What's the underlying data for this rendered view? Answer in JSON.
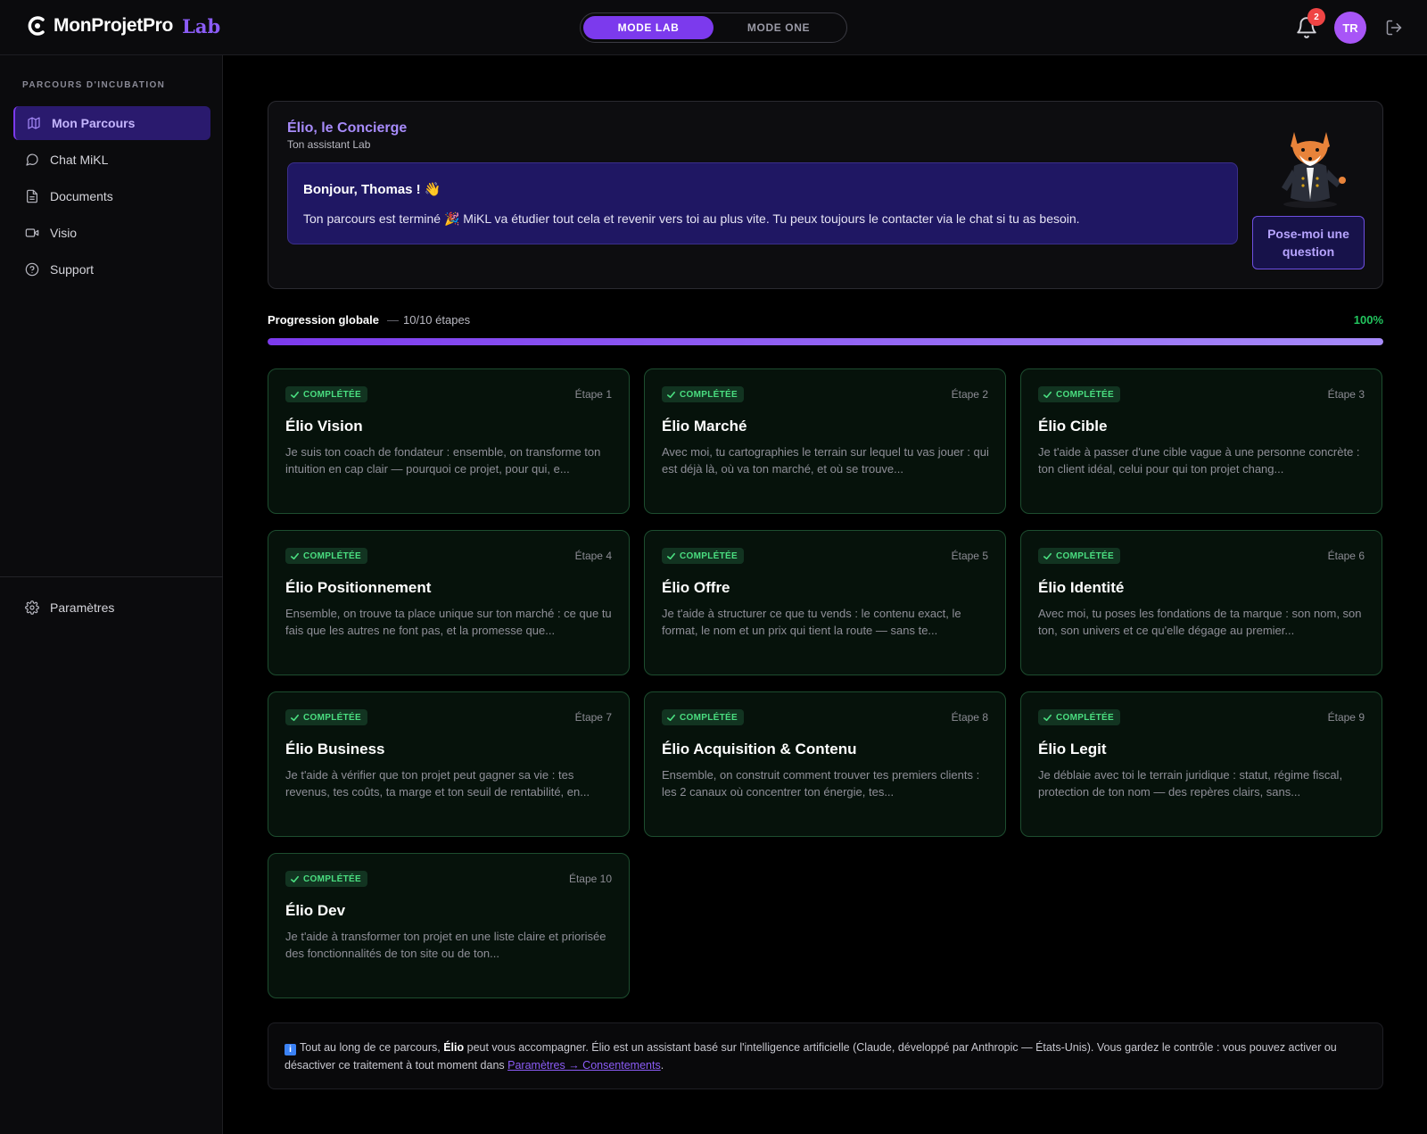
{
  "brand": {
    "name": "MonProjetPro",
    "suffix": "Lab"
  },
  "modes": [
    {
      "label": "MODE LAB",
      "active": true
    },
    {
      "label": "MODE ONE",
      "active": false
    }
  ],
  "notifications": {
    "count": "2"
  },
  "user": {
    "initials": "TR"
  },
  "sidebar": {
    "heading": "PARCOURS D'INCUBATION",
    "items": [
      {
        "label": "Mon Parcours",
        "icon": "map-icon",
        "active": true
      },
      {
        "label": "Chat MiKL",
        "icon": "chat-bubble-icon"
      },
      {
        "label": "Documents",
        "icon": "document-icon"
      },
      {
        "label": "Visio",
        "icon": "video-camera-icon"
      },
      {
        "label": "Support",
        "icon": "help-circle-icon"
      }
    ],
    "settings": {
      "label": "Paramètres",
      "icon": "gear-icon"
    }
  },
  "concierge": {
    "title": "Élio, le Concierge",
    "subtitle": "Ton assistant Lab",
    "greeting": "Bonjour, Thomas ! 👋",
    "message": "Ton parcours est terminé 🎉 MiKL va étudier tout cela et revenir vers toi au plus vite. Tu peux toujours le contacter via le chat si tu as besoin.",
    "ask_button": "Pose-moi une question"
  },
  "progress": {
    "label": "Progression globale",
    "separator": "—",
    "steps_text": "10/10 étapes",
    "percent_text": "100%",
    "value": 1.0
  },
  "steps": [
    {
      "badge": "COMPLÉTÉE",
      "step": "Étape 1",
      "title": "Élio Vision",
      "desc": "Je suis ton coach de fondateur : ensemble, on transforme ton intuition en cap clair — pourquoi ce projet, pour qui, e..."
    },
    {
      "badge": "COMPLÉTÉE",
      "step": "Étape 2",
      "title": "Élio Marché",
      "desc": "Avec moi, tu cartographies le terrain sur lequel tu vas jouer : qui est déjà là, où va ton marché, et où se trouve..."
    },
    {
      "badge": "COMPLÉTÉE",
      "step": "Étape 3",
      "title": "Élio Cible",
      "desc": "Je t'aide à passer d'une cible vague à une personne concrète : ton client idéal, celui pour qui ton projet chang..."
    },
    {
      "badge": "COMPLÉTÉE",
      "step": "Étape 4",
      "title": "Élio Positionnement",
      "desc": "Ensemble, on trouve ta place unique sur ton marché : ce que tu fais que les autres ne font pas, et la promesse que..."
    },
    {
      "badge": "COMPLÉTÉE",
      "step": "Étape 5",
      "title": "Élio Offre",
      "desc": "Je t'aide à structurer ce que tu vends : le contenu exact, le format, le nom et un prix qui tient la route — sans te..."
    },
    {
      "badge": "COMPLÉTÉE",
      "step": "Étape 6",
      "title": "Élio Identité",
      "desc": "Avec moi, tu poses les fondations de ta marque : son nom, son ton, son univers et ce qu'elle dégage au premier..."
    },
    {
      "badge": "COMPLÉTÉE",
      "step": "Étape 7",
      "title": "Élio Business",
      "desc": "Je t'aide à vérifier que ton projet peut gagner sa vie : tes revenus, tes coûts, ta marge et ton seuil de rentabilité, en..."
    },
    {
      "badge": "COMPLÉTÉE",
      "step": "Étape 8",
      "title": "Élio Acquisition & Contenu",
      "desc": "Ensemble, on construit comment trouver tes premiers clients : les 2 canaux où concentrer ton énergie, tes..."
    },
    {
      "badge": "COMPLÉTÉE",
      "step": "Étape 9",
      "title": "Élio Legit",
      "desc": "Je déblaie avec toi le terrain juridique : statut, régime fiscal, protection de ton nom — des repères clairs, sans..."
    },
    {
      "badge": "COMPLÉTÉE",
      "step": "Étape 10",
      "title": "Élio Dev",
      "desc": "Je t'aide à transformer ton projet en une liste claire et priorisée des fonctionnalités de ton site ou de ton..."
    }
  ],
  "info": {
    "icon": "info-icon",
    "icon_glyph": "i",
    "prefix": "Tout au long de ce parcours, ",
    "bold": "Élio",
    "middle": " peut vous accompagner. Élio est un assistant basé sur l'intelligence artificielle (Claude, développé par Anthropic — États-Unis). Vous gardez le contrôle : vous pouvez activer ou désactiver ce traitement à tout moment dans ",
    "link": "Paramètres → Consentements",
    "suffix": "."
  },
  "colors": {
    "accent": "#7c3aed",
    "success": "#22c55e",
    "card_border": "#1d4d2f"
  }
}
